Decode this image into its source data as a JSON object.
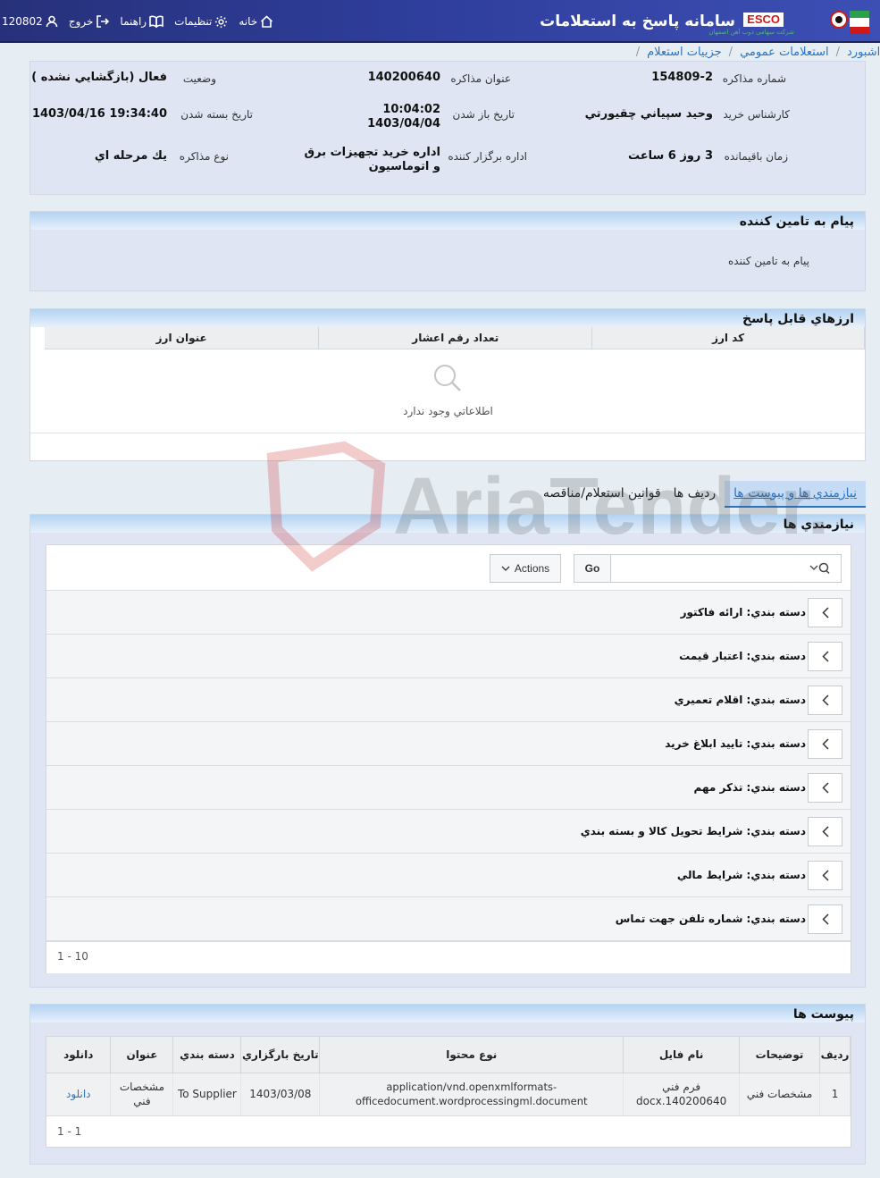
{
  "header": {
    "title": "سامانه پاسخ به استعلامات",
    "esco": "ESCO",
    "esco_sub": "شرکت سهامی ذوب آهن اصفهان",
    "nav": {
      "home": "خانه",
      "settings": "تنظیمات",
      "help": "راهنما",
      "logout": "خروج",
      "user_id": "120802"
    }
  },
  "breadcrumb": [
    "داشبورد",
    "استعلامات عمومي",
    "جزييات استعلام"
  ],
  "info": {
    "number_label": "شماره مذاكره",
    "number_value": "154809-2",
    "subject_label": "عنوان مذاكره",
    "subject_value": "140200640",
    "status_label": "وضعيت",
    "status_value": "فعال (بازگشايي نشده )",
    "expert_label": "كارشناس خريد",
    "expert_value": "وحيد سپياني چقيورتي",
    "open_label": "تاريخ باز شدن",
    "open_time": "10:04:02",
    "open_date": "1403/04/04",
    "close_label": "تاريخ بسته شدن",
    "close_value": "1403/04/16 19:34:40",
    "remaining_label": "زمان باقيمانده",
    "remaining_value": "3 روز 6 ساعت",
    "dept_label": "اداره برگزار كننده",
    "dept_line1": "اداره خريد تجهيزات برق",
    "dept_line2": "و اتوماسيون",
    "type_label": "نوع مذاكره",
    "type_value": "يك مرحله اي"
  },
  "message": {
    "title": "پيام به تامين كننده",
    "body": "پيام به تامين كننده"
  },
  "currencies": {
    "title": "ارزهاي قابل پاسخ",
    "columns": [
      "كد ارز",
      "تعداد رقم اعشار",
      "عنوان ارز"
    ],
    "empty": "اطلاعاتي وجود ندارد"
  },
  "tabs": [
    "نيازمندي ها و پيوست ها",
    "رديف ها",
    "قوانين استعلام/مناقصه"
  ],
  "requirements": {
    "title": "نيازمندي ها",
    "go": "Go",
    "actions": "Actions",
    "items": [
      "دسته بندي: ارائه فاكتور",
      "دسته بندي: اعتبار قيمت",
      "دسته بندي: اقلام تعميري",
      "دسته بندي: تاييد ابلاغ خريد",
      "دسته بندي: تذكر مهم",
      "دسته بندي: شرايط تحويل كالا و بسته بندي",
      "دسته بندي: شرايط مالي",
      "دسته بندي: شماره تلفن جهت تماس"
    ],
    "pagination": "1 - 10"
  },
  "attachments": {
    "title": "پيوست ها",
    "columns": [
      "رديف",
      "توضيحات",
      "نام فايل",
      "نوع محتوا",
      "تاريخ بارگزاري",
      "دسته بندي",
      "عنوان",
      "دانلود"
    ],
    "rows": [
      [
        "1",
        "مشخصات فني",
        "فرم فني 140200640.docx",
        "application/vnd.openxmlformats-officedocument.wordprocessingml.document",
        "1403/03/08",
        "To Supplier",
        "مشخصات فني",
        "دانلود"
      ]
    ],
    "pagination": "1 - 1"
  },
  "watermark": "AriaTender.neT",
  "colors": {
    "header": "#2e3d9a",
    "link": "#2a74c4",
    "panel": "#dfe5f3"
  }
}
